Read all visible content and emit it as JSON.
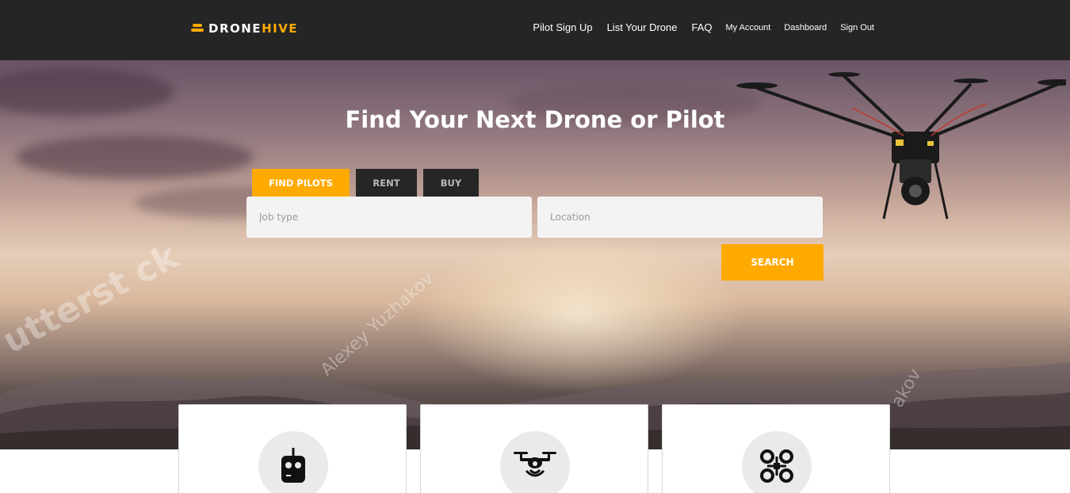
{
  "brand": {
    "part1": "DRONE",
    "part2": "HIVE",
    "accent": "#ffaa00"
  },
  "nav": {
    "pilot_signup": "Pilot Sign Up",
    "list_drone": "List Your Drone",
    "faq": "FAQ",
    "my_account": "My Account",
    "dashboard": "Dashboard",
    "sign_out": "Sign Out"
  },
  "hero": {
    "title": "Find Your Next Drone or Pilot",
    "tabs": [
      "FIND PILOTS",
      "RENT",
      "BUY"
    ],
    "active_tab": "FIND PILOTS",
    "job_placeholder": "Job type",
    "location_placeholder": "Location",
    "search_label": "SEARCH",
    "watermarks": [
      "utterst",
      "ck",
      "Alexey Yuzhakov",
      "akov"
    ]
  },
  "cards": [
    {
      "icon": "remote-controller-icon"
    },
    {
      "icon": "camera-drone-icon"
    },
    {
      "icon": "quadcopter-icon"
    }
  ],
  "colors": {
    "nav_bg": "#252525",
    "tab_bg": "#262626",
    "field_bg": "#f3f3f3"
  }
}
